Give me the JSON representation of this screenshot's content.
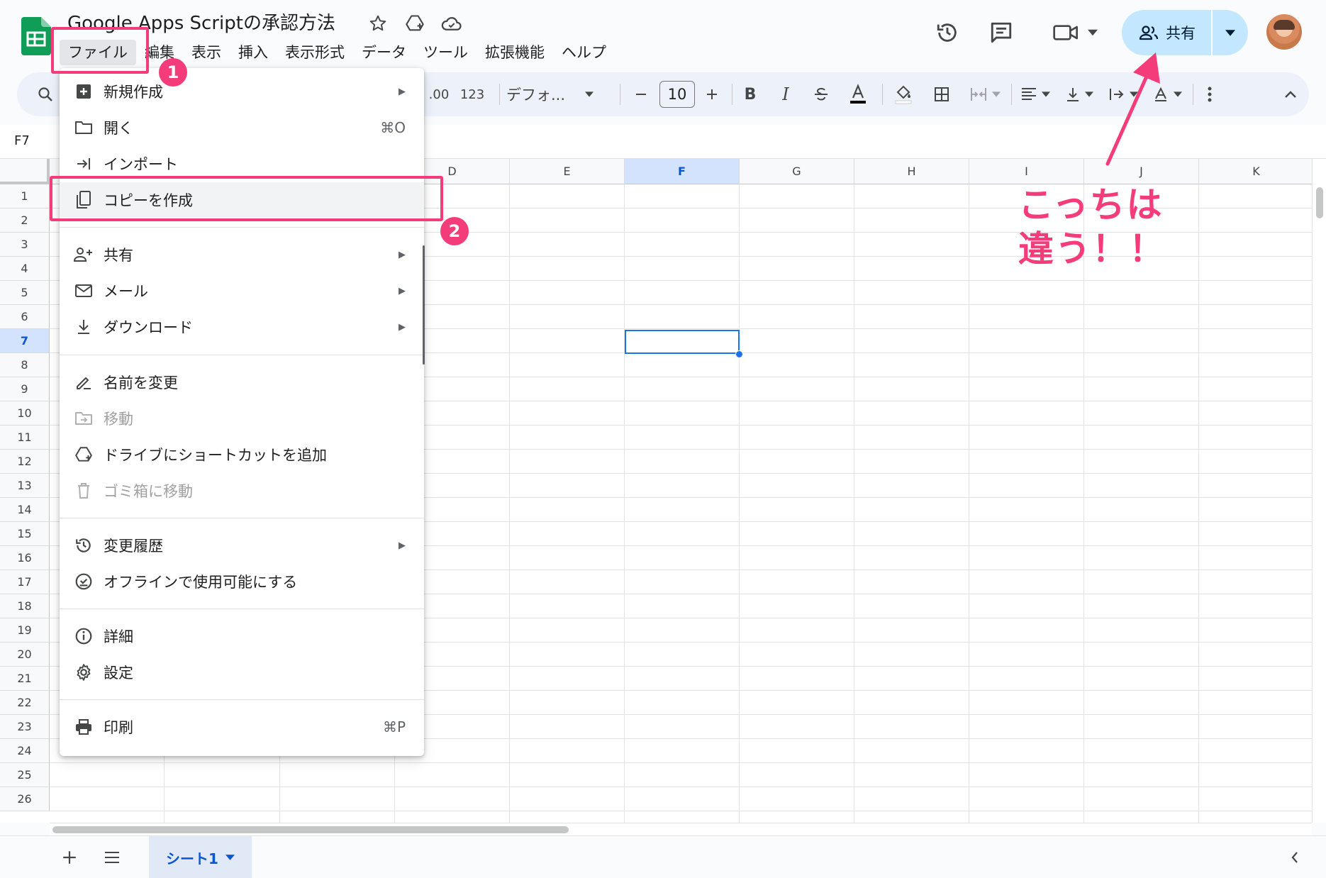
{
  "header": {
    "title": "Google Apps Scriptの承認方法",
    "menu": [
      "ファイル",
      "編集",
      "表示",
      "挿入",
      "表示形式",
      "データ",
      "ツール",
      "拡張機能",
      "ヘルプ"
    ],
    "share_label": "共有"
  },
  "toolbar": {
    "format_number": "123",
    "font_name": "デフォ...",
    "font_size": "10",
    "decimal_label": ".00"
  },
  "formula_bar": {
    "cell_ref": "F7"
  },
  "grid": {
    "columns": [
      "D",
      "E",
      "F",
      "G",
      "H",
      "I",
      "J",
      "K"
    ],
    "rows": [
      "1",
      "2",
      "3",
      "4",
      "5",
      "6",
      "7",
      "8",
      "9",
      "10",
      "11",
      "12",
      "13",
      "14",
      "15",
      "16",
      "17",
      "18",
      "19",
      "20",
      "21",
      "22",
      "23",
      "24",
      "25",
      "26"
    ],
    "selected_column": "F",
    "selected_row": "7"
  },
  "file_menu": {
    "new": "新規作成",
    "open": "開く",
    "open_shortcut": "⌘O",
    "import": "インポート",
    "make_copy": "コピーを作成",
    "share": "共有",
    "email": "メール",
    "download": "ダウンロード",
    "rename": "名前を変更",
    "move": "移動",
    "add_shortcut": "ドライブにショートカットを追加",
    "trash": "ゴミ箱に移動",
    "version_history": "変更履歴",
    "offline": "オフラインで使用可能にする",
    "details": "詳細",
    "settings": "設定",
    "print": "印刷",
    "print_shortcut": "⌘P"
  },
  "sheets": {
    "tab_label": "シート1"
  },
  "annotations": {
    "step1": "1",
    "step2": "2",
    "note_line1": "こっちは",
    "note_line2": "違う！！"
  },
  "colors": {
    "annotation": "#f53c7a",
    "share_button": "#c2e7ff",
    "selection": "#1a73e8",
    "sheets_green": "#0f9d58"
  }
}
